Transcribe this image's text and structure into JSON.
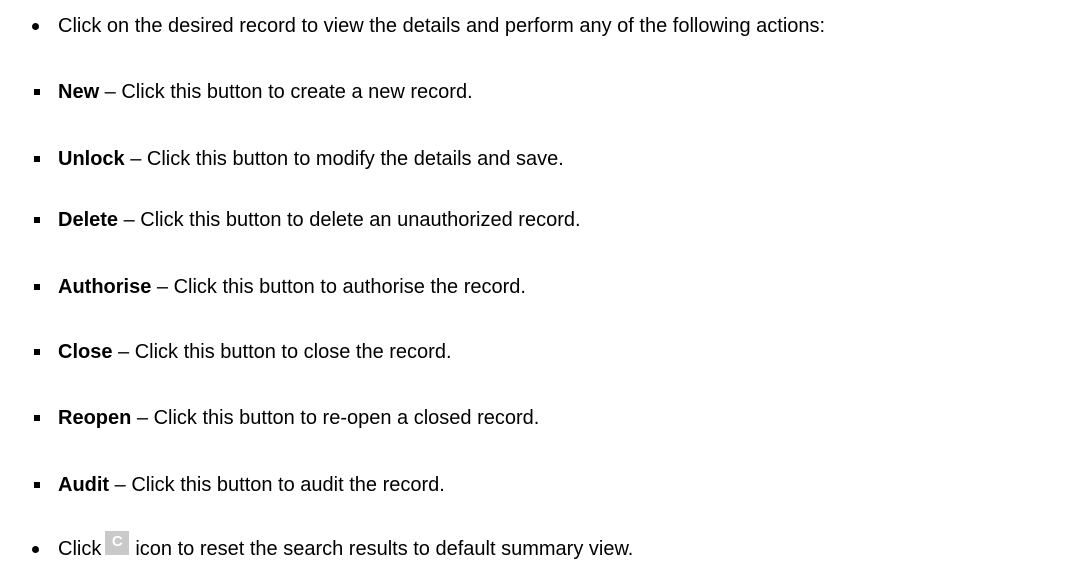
{
  "intro": {
    "text": "Click on the desired record to view the details and perform any of the following actions:"
  },
  "actions": [
    {
      "name": "New",
      "description": " – Click this button to create a new record."
    },
    {
      "name": "Unlock",
      "description": " – Click this button to modify the details and save."
    },
    {
      "name": "Delete",
      "description": " – Click this button to delete an unauthorized record."
    },
    {
      "name": "Authorise",
      "description": " – Click this button to authorise the record."
    },
    {
      "name": "Close",
      "description": " – Click this button to close the record."
    },
    {
      "name": "Reopen",
      "description": " – Click this button to re-open a closed record."
    },
    {
      "name": "Audit",
      "description": " – Click this button to audit the record."
    }
  ],
  "reset_note": {
    "before": "Click",
    "icon": "refresh-icon",
    "icon_glyph": "C",
    "after": "icon to reset the search results to default summary view."
  }
}
